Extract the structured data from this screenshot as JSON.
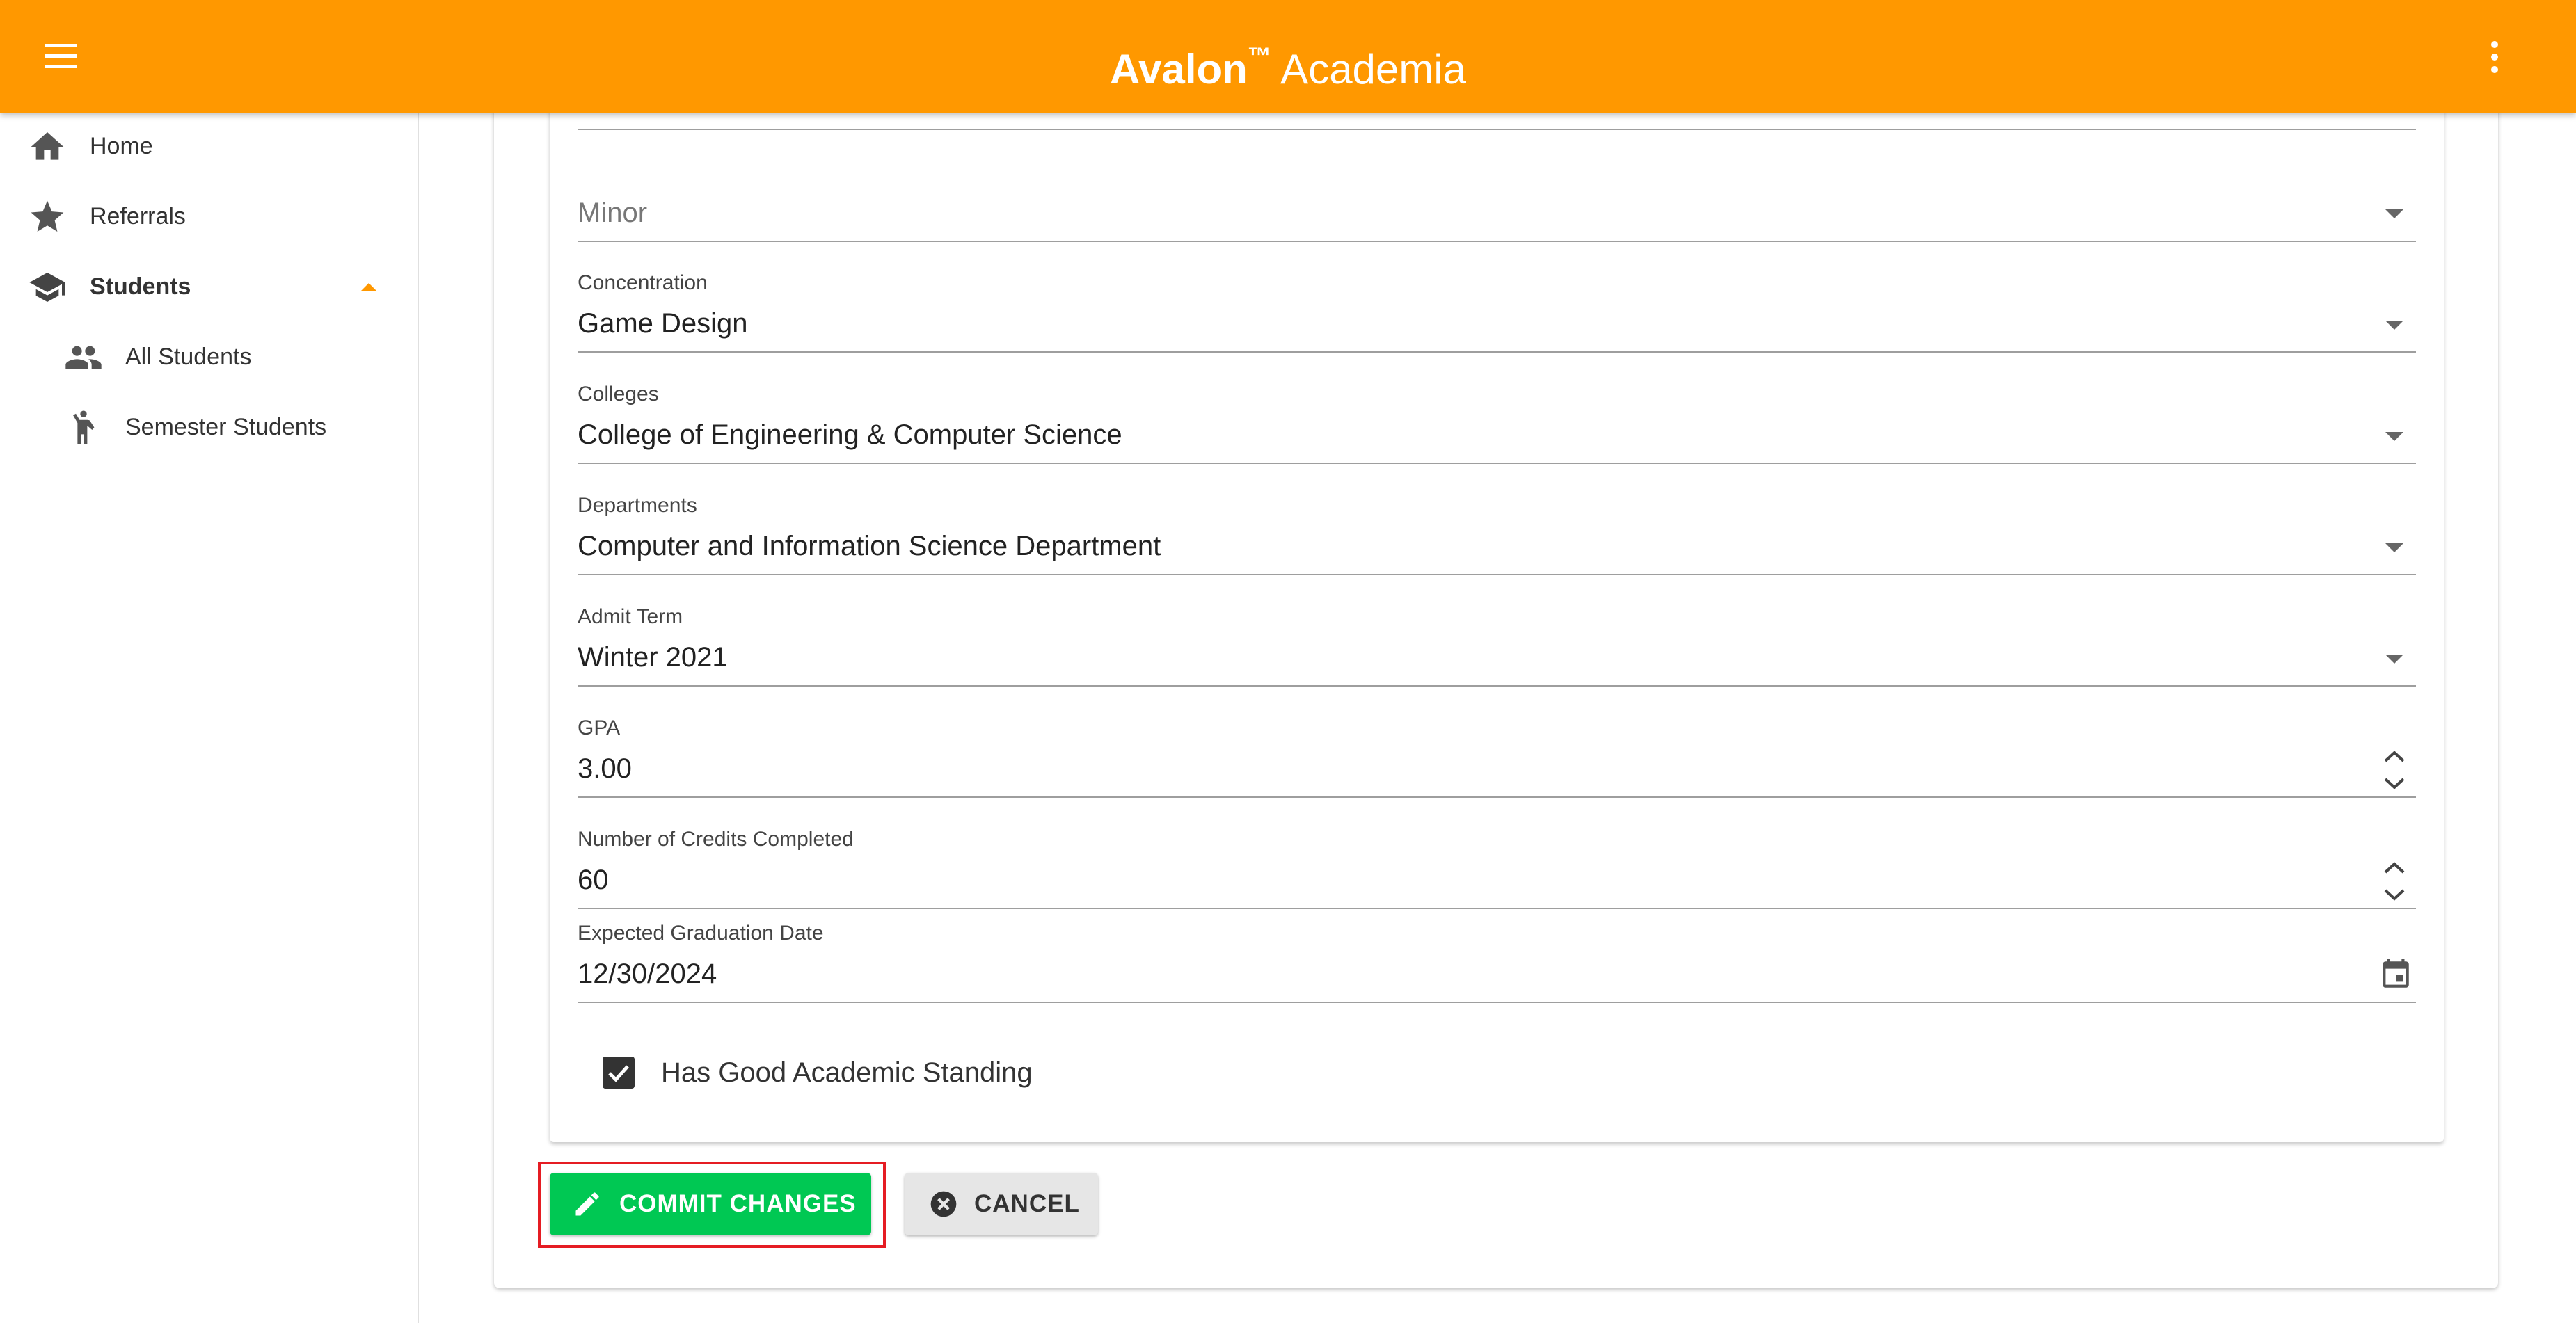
{
  "app": {
    "brand_name": "Avalon",
    "trademark": "™",
    "brand_suffix": "Academia",
    "accent_color": "#ff9800",
    "icons": {
      "menu": "menu-icon",
      "more": "more-vert-icon"
    }
  },
  "sidebar": {
    "items": [
      {
        "label": "Home",
        "icon": "home-icon"
      },
      {
        "label": "Referrals",
        "icon": "star-icon"
      },
      {
        "label": "Students",
        "icon": "school-icon",
        "expanded": true,
        "bold": true
      },
      {
        "label": "All Students",
        "icon": "people-icon",
        "sub": true
      },
      {
        "label": "Semester Students",
        "icon": "person-walking-icon",
        "sub": true
      }
    ]
  },
  "form": {
    "minor": {
      "placeholder": "Minor",
      "value": ""
    },
    "concentration": {
      "label": "Concentration",
      "value": "Game Design"
    },
    "colleges": {
      "label": "Colleges",
      "value": "College of Engineering & Computer Science"
    },
    "departments": {
      "label": "Departments",
      "value": "Computer and Information Science Department"
    },
    "admit_term": {
      "label": "Admit Term",
      "value": "Winter 2021"
    },
    "gpa": {
      "label": "GPA",
      "value": "3.00"
    },
    "credits": {
      "label": "Number of Credits Completed",
      "value": "60"
    },
    "graduation": {
      "label": "Expected Graduation Date",
      "value": "12/30/2024"
    },
    "good_standing": {
      "label": "Has Good Academic Standing",
      "checked": true
    }
  },
  "actions": {
    "commit_label": "COMMIT CHANGES",
    "cancel_label": "CANCEL",
    "commit_color": "#00c853",
    "highlight_color": "#e51c23"
  }
}
